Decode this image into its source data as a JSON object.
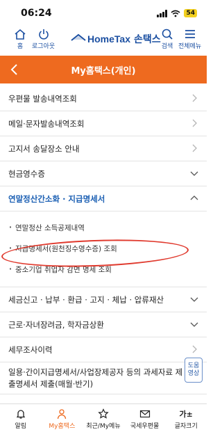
{
  "status_bar": {
    "time": "06:24",
    "battery": "54"
  },
  "header": {
    "home_label": "홈",
    "logout_label": "로그아웃",
    "brand_en": "HomeTax",
    "brand_ko": "손택스",
    "search_label": "검색",
    "menu_label": "전체메뉴"
  },
  "title_bar": {
    "title": "My홈택스(개인)"
  },
  "menu": {
    "items": [
      {
        "label": "우편물 발송내역조회"
      },
      {
        "label": "메일·문자발송내역조회"
      },
      {
        "label": "고지서 송달장소 안내"
      },
      {
        "label": "현금영수증"
      },
      {
        "label": "연말정산간소화 · 지급명세서"
      }
    ],
    "sub_items": [
      {
        "label": "연말정산 소득공제내역"
      },
      {
        "label": "지급명세서(원천징수영수증) 조회"
      },
      {
        "label": "중소기업 취업자 감면 명세 조회"
      }
    ],
    "items_after": [
      {
        "label": "세금신고 · 납부 · 환급 · 고지 · 체납 · 압류재산"
      },
      {
        "label": "근로·자녀장려금, 학자금상환"
      },
      {
        "label": "세무조사이력"
      },
      {
        "label": "일용·간이지급명세서/사업장제공자 등의 과세자료 제출명세서 제출(매월·반기)"
      }
    ]
  },
  "help_button": {
    "line1": "도움",
    "line2": "영상"
  },
  "bottom_nav": {
    "items": [
      {
        "label": "알림"
      },
      {
        "label": "My홈택스"
      },
      {
        "label": "최근/My메뉴"
      },
      {
        "label": "국세우편물"
      },
      {
        "label": "글자크기"
      }
    ],
    "font_size_icon_text": "가±"
  },
  "colors": {
    "accent": "#ee6a1f",
    "brand": "#1b4fa1",
    "active_menu": "#1b5fb3",
    "annotation": "#e03a2e"
  }
}
